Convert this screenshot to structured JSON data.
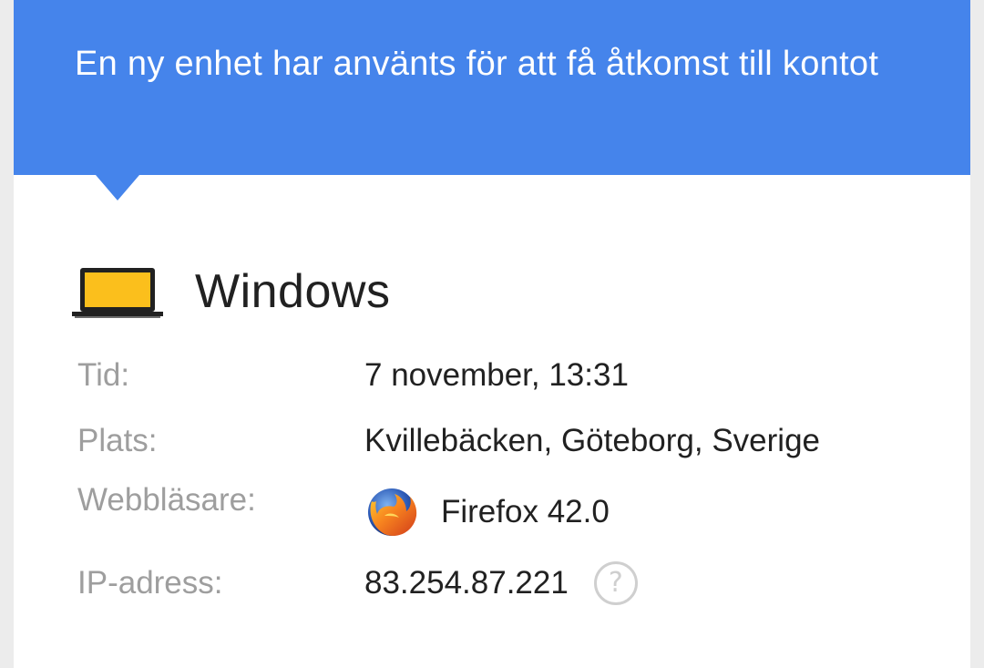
{
  "banner": {
    "text": "En ny enhet har använts för att få åtkomst till kontot",
    "color": "#4584eb"
  },
  "device": {
    "icon": "laptop-icon",
    "name": "Windows"
  },
  "details": {
    "time": {
      "label": "Tid:",
      "value": "7 november, 13:31"
    },
    "location": {
      "label": "Plats:",
      "value": "Kvillebäcken, Göteborg, Sverige"
    },
    "browser": {
      "label": "Webbläsare:",
      "icon": "firefox-icon",
      "value": "Firefox 42.0"
    },
    "ip": {
      "label": "IP-adress:",
      "value": "83.254.87.221",
      "help_icon": "question-circle-icon",
      "help_glyph": "?"
    }
  }
}
